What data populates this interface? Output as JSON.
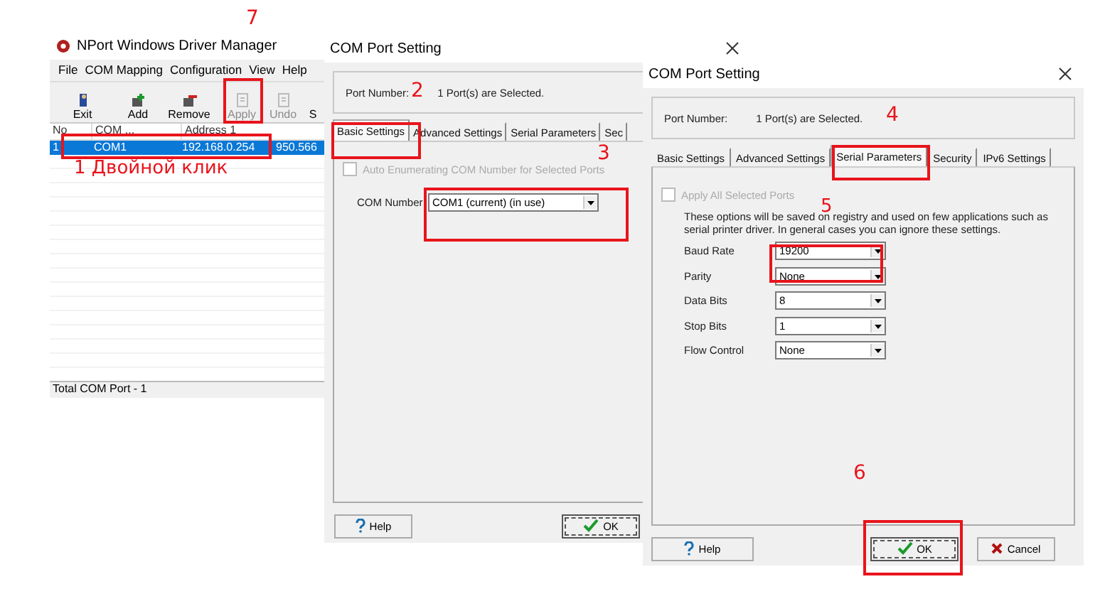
{
  "manager": {
    "title": "NPort Windows Driver Manager",
    "menu": [
      "File",
      "COM Mapping",
      "Configuration",
      "View",
      "Help"
    ],
    "toolbar": [
      {
        "label": "Exit",
        "disabled": false
      },
      {
        "label": "Add",
        "disabled": false
      },
      {
        "label": "Remove",
        "disabled": false
      },
      {
        "label": "Apply",
        "disabled": true
      },
      {
        "label": "Undo",
        "disabled": true
      },
      {
        "label": "S",
        "disabled": false
      }
    ],
    "columns": [
      "No",
      "COM ...",
      "Address 1"
    ],
    "rows": [
      {
        "cells": [
          "1",
          "COM1",
          "192.168.0.254",
          "950.566"
        ],
        "selected": true
      }
    ],
    "status_bar": "Total COM Port - 1"
  },
  "dialog_basic": {
    "title": "COM Port Setting",
    "port_label": "Port Number:",
    "port_value": "1 Port(s) are Selected.",
    "tabs": [
      {
        "label": "Basic Settings",
        "selected": true
      },
      {
        "label": "Advanced Settings",
        "selected": false
      },
      {
        "label": "Serial Parameters",
        "selected": false
      },
      {
        "label": "Sec",
        "selected": false
      }
    ],
    "checkbox": {
      "label": "Auto Enumerating COM Number for Selected Ports",
      "checked": false,
      "disabled": true
    },
    "com_number": {
      "label": "COM Number",
      "value": "COM1  (current) (in use)"
    },
    "buttons": [
      "Help",
      "OK"
    ]
  },
  "dialog_serial": {
    "title": "COM Port Setting",
    "port_label": "Port Number:",
    "port_value": "1 Port(s) are Selected.",
    "tabs": [
      {
        "label": "Basic Settings",
        "selected": false
      },
      {
        "label": "Advanced Settings",
        "selected": false
      },
      {
        "label": "Serial Parameters",
        "selected": true
      },
      {
        "label": "Security",
        "selected": false
      },
      {
        "label": "IPv6 Settings",
        "selected": false
      }
    ],
    "checkbox": {
      "label": "Apply All Selected Ports",
      "checked": false,
      "disabled": true
    },
    "note": "These options will be saved on registry and used on few applications such as serial printer driver. In general cases you can ignore these settings.",
    "fields": [
      {
        "label": "Baud Rate",
        "value": "19200"
      },
      {
        "label": "Parity",
        "value": "None"
      },
      {
        "label": "Data Bits",
        "value": "8"
      },
      {
        "label": "Stop Bits",
        "value": "1"
      },
      {
        "label": "Flow Control",
        "value": "None"
      }
    ],
    "buttons": [
      "Help",
      "OK",
      "Cancel"
    ]
  },
  "annotations": [
    "7",
    "2",
    "3",
    "4",
    "5",
    "6",
    "1 Двойной клик"
  ]
}
